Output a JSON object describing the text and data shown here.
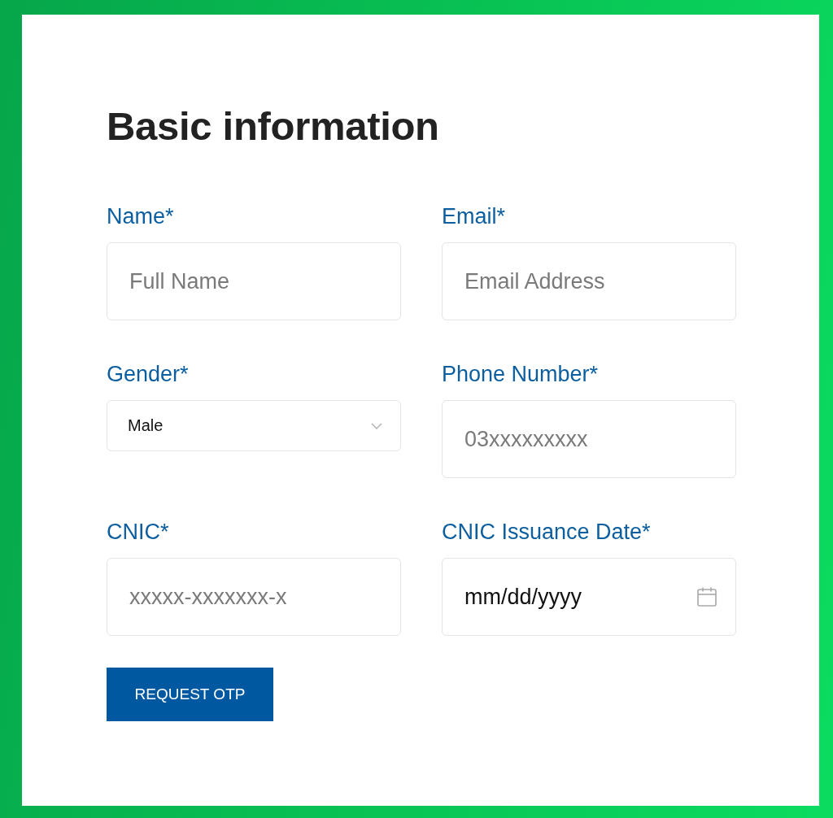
{
  "heading": "Basic information",
  "fields": [
    {
      "kind": "text",
      "label": "Name*",
      "placeholder": "Full Name"
    },
    {
      "kind": "text",
      "label": "Email*",
      "placeholder": "Email Address"
    },
    {
      "kind": "select",
      "label": "Gender*",
      "value": "Male"
    },
    {
      "kind": "text",
      "label": "Phone Number*",
      "placeholder": "03xxxxxxxxx"
    },
    {
      "kind": "text",
      "label": "CNIC*",
      "placeholder": "xxxxx-xxxxxxx-x"
    },
    {
      "kind": "date",
      "label": "CNIC Issuance Date*",
      "placeholder": "mm/dd/yyyy"
    }
  ],
  "button": {
    "label": "REQUEST OTP"
  }
}
